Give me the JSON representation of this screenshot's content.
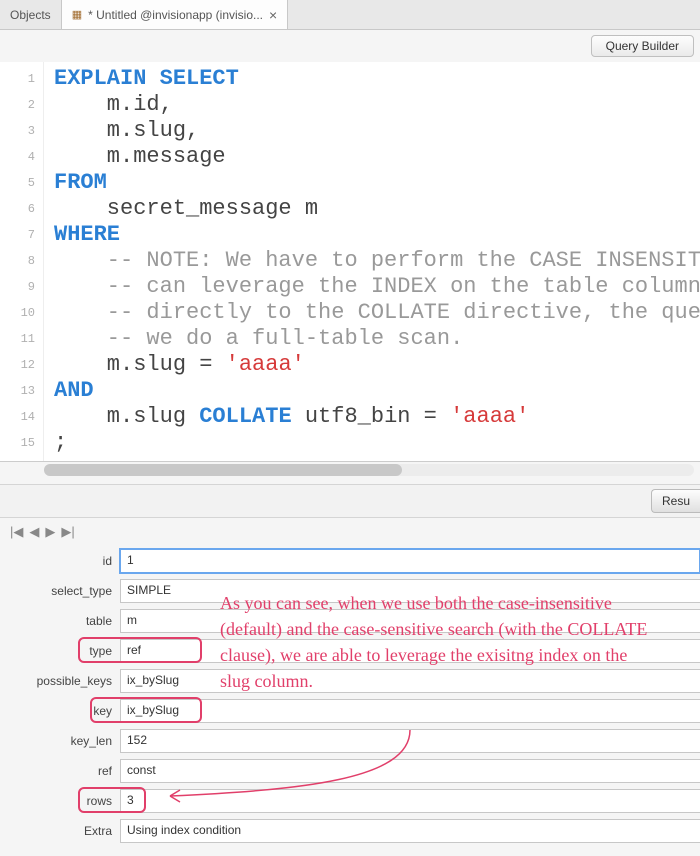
{
  "tabs": {
    "objects": "Objects",
    "active": "* Untitled @invisionapp (invisio..."
  },
  "toolbar": {
    "query_builder": "Query Builder"
  },
  "code": [
    {
      "cls": "kw",
      "text": "EXPLAIN SELECT"
    },
    {
      "cls": "",
      "text": "    m.id,"
    },
    {
      "cls": "",
      "text": "    m.slug,"
    },
    {
      "cls": "",
      "text": "    m.message"
    },
    {
      "cls": "kw",
      "text": "FROM"
    },
    {
      "cls": "",
      "text": "    secret_message m"
    },
    {
      "cls": "kw",
      "text": "WHERE"
    },
    {
      "cls": "cmt",
      "text": "    -- NOTE: We have to perform the CASE INSENSIT"
    },
    {
      "cls": "cmt",
      "text": "    -- can leverage the INDEX on the table column"
    },
    {
      "cls": "cmt",
      "text": "    -- directly to the COLLATE directive, the que"
    },
    {
      "cls": "cmt",
      "text": "    -- we do a full-table scan."
    },
    {
      "cls": "mix1",
      "text": ""
    },
    {
      "cls": "kw",
      "text": "AND"
    },
    {
      "cls": "mix2",
      "text": ""
    },
    {
      "cls": "",
      "text": ";"
    }
  ],
  "mix1": {
    "pre": "    m.slug = ",
    "str": "'aaaa'"
  },
  "mix2": {
    "pre": "    m.slug ",
    "kw": "COLLATE",
    "mid": " utf8_bin = ",
    "str": "'aaaa'"
  },
  "results_tab": "Resu",
  "explain": {
    "id": {
      "label": "id",
      "value": "1"
    },
    "select_type": {
      "label": "select_type",
      "value": "SIMPLE"
    },
    "table": {
      "label": "table",
      "value": "m"
    },
    "type": {
      "label": "type",
      "value": "ref"
    },
    "possible_keys": {
      "label": "possible_keys",
      "value": "ix_bySlug"
    },
    "key": {
      "label": "key",
      "value": "ix_bySlug"
    },
    "key_len": {
      "label": "key_len",
      "value": "152"
    },
    "ref": {
      "label": "ref",
      "value": "const"
    },
    "rows": {
      "label": "rows",
      "value": "3"
    },
    "extra": {
      "label": "Extra",
      "value": "Using index condition"
    }
  },
  "annotation": "As you can see, when we use both the case-insensitive (default) and the case-sensitive search (with the COLLATE clause), we are able to leverage the exisitng index on the slug column.",
  "highlighted_rows": [
    "type",
    "key",
    "rows"
  ]
}
